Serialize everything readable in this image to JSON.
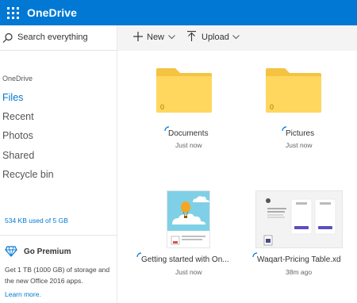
{
  "app": {
    "title": "OneDrive"
  },
  "header": {
    "waffle_icon": "waffle-icon",
    "brand_color": "#0078d4"
  },
  "sidebar": {
    "search_placeholder": "Search everything",
    "section_label": "OneDrive",
    "items": [
      {
        "label": "Files",
        "active": true
      },
      {
        "label": "Recent",
        "active": false
      },
      {
        "label": "Photos",
        "active": false
      },
      {
        "label": "Shared",
        "active": false
      },
      {
        "label": "Recycle bin",
        "active": false
      }
    ],
    "storage": "534 KB used of 5 GB",
    "premium": {
      "title": "Go Premium",
      "description": "Get 1 TB (1000 GB) of storage and the new Office 2016 apps.",
      "link": "Learn more."
    }
  },
  "commandbar": {
    "new_label": "New",
    "upload_label": "Upload"
  },
  "items": [
    {
      "type": "folder",
      "name": "Documents",
      "modified": "Just now",
      "count": "0"
    },
    {
      "type": "folder",
      "name": "Pictures",
      "modified": "Just now",
      "count": "0"
    },
    {
      "type": "file",
      "name": "Getting started with On...",
      "modified": "Just now",
      "thumb_caption": "Get started with OneDrive"
    },
    {
      "type": "file",
      "name": "Waqart-Pricing Table.xd",
      "modified": "38m ago",
      "thumb_caption": "XD"
    }
  ],
  "colors": {
    "accent": "#0078d4",
    "folder": "#ffd75e",
    "folder_tab": "#f5c342"
  }
}
